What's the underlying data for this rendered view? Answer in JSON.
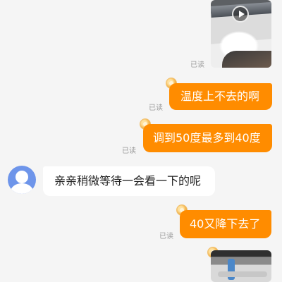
{
  "read_status": "已读",
  "messages": [
    {
      "type": "video",
      "direction": "out"
    },
    {
      "type": "text",
      "direction": "out",
      "text": "温度上不去的啊"
    },
    {
      "type": "text",
      "direction": "out",
      "text": "调到50度最多到40度"
    },
    {
      "type": "text",
      "direction": "in",
      "text": "亲亲稍微等待一会看一下的呢"
    },
    {
      "type": "text",
      "direction": "out",
      "text": "40又降下去了"
    },
    {
      "type": "image",
      "direction": "out"
    }
  ],
  "colors": {
    "outgoing_bubble": "#ff8c00",
    "incoming_bubble": "#ffffff",
    "background": "#f5f5f5",
    "read_text": "#9a9a9a"
  }
}
